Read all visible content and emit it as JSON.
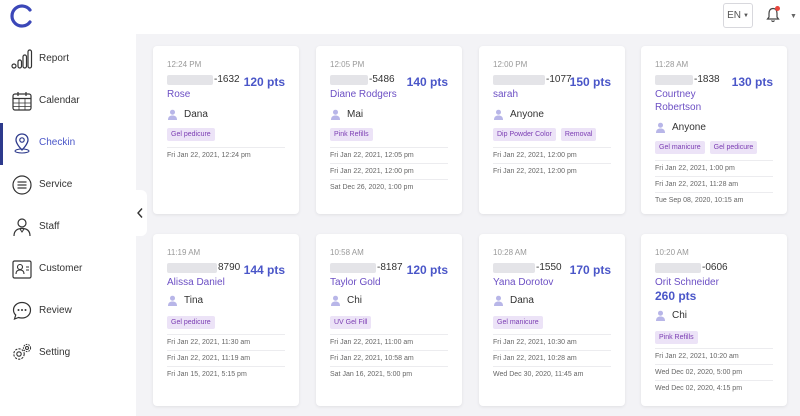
{
  "header": {
    "language": "EN"
  },
  "sidebar": {
    "items": [
      {
        "label": "Report",
        "icon": "bar-chart-icon"
      },
      {
        "label": "Calendar",
        "icon": "calendar-icon"
      },
      {
        "label": "Checkin",
        "icon": "location-pin-icon"
      },
      {
        "label": "Service",
        "icon": "list-icon"
      },
      {
        "label": "Staff",
        "icon": "staff-icon"
      },
      {
        "label": "Customer",
        "icon": "customer-icon"
      },
      {
        "label": "Review",
        "icon": "chat-icon"
      },
      {
        "label": "Setting",
        "icon": "gear-icon"
      }
    ],
    "active": "Checkin"
  },
  "cards": [
    {
      "time": "12:24 PM",
      "phone_suffix": "-1632",
      "points": "120 pts",
      "name": "Rose",
      "staff": "Dana",
      "services": [
        "Gel pedicure"
      ],
      "visits": [
        "Fri Jan 22, 2021, 12:24 pm"
      ]
    },
    {
      "time": "12:05 PM",
      "phone_suffix": "-5486",
      "points": "140 pts",
      "name": "Diane Rodgers",
      "staff": "Mai",
      "services": [
        "Pink Refills"
      ],
      "visits": [
        "Fri Jan 22, 2021, 12:05 pm",
        "Fri Jan 22, 2021, 12:00 pm",
        "Sat Dec 26, 2020, 1:00 pm"
      ]
    },
    {
      "time": "12:00 PM",
      "phone_suffix": "-1077",
      "points": "150 pts",
      "name": "sarah",
      "staff": "Anyone",
      "services": [
        "Dip Powder Color",
        "Removal"
      ],
      "visits": [
        "Fri Jan 22, 2021, 12:00 pm",
        "Fri Jan 22, 2021, 12:00 pm"
      ]
    },
    {
      "time": "11:28 AM",
      "phone_suffix": "-1838",
      "points": "130 pts",
      "name": "Courtney Robertson",
      "staff": "Anyone",
      "services": [
        "Gel manicure",
        "Gel pedicure"
      ],
      "visits": [
        "Fri Jan 22, 2021, 1:00 pm",
        "Fri Jan 22, 2021, 11:28 am",
        "Tue Sep 08, 2020, 10:15 am"
      ]
    },
    {
      "time": "11:19 AM",
      "phone_suffix": "8790",
      "points": "144 pts",
      "name": "Alissa Daniel",
      "staff": "Tina",
      "services": [
        "Gel pedicure"
      ],
      "visits": [
        "Fri Jan 22, 2021, 11:30 am",
        "Fri Jan 22, 2021, 11:19 am",
        "Fri Jan 15, 2021, 5:15 pm"
      ]
    },
    {
      "time": "10:58 AM",
      "phone_suffix": "-8187",
      "points": "120 pts",
      "name": "Taylor Gold",
      "staff": "Chi",
      "services": [
        "UV Gel Fill"
      ],
      "visits": [
        "Fri Jan 22, 2021, 11:00 am",
        "Fri Jan 22, 2021, 10:58 am",
        "Sat Jan 16, 2021, 5:00 pm"
      ]
    },
    {
      "time": "10:28 AM",
      "phone_suffix": "-1550",
      "points": "170 pts",
      "name": "Yana Dorotov",
      "staff": "Dana",
      "services": [
        "Gel manicure"
      ],
      "visits": [
        "Fri Jan 22, 2021, 10:30 am",
        "Fri Jan 22, 2021, 10:28 am",
        "Wed Dec 30, 2020, 11:45 am"
      ]
    },
    {
      "time": "10:20 AM",
      "phone_suffix": "-0606",
      "points": "260 pts",
      "name": "Orit Schneider",
      "staff": "Chi",
      "services": [
        "Pink Refills"
      ],
      "visits": [
        "Fri Jan 22, 2021, 10:20 am",
        "Wed Dec 02, 2020, 5:00 pm",
        "Wed Dec 02, 2020, 4:15 pm"
      ]
    }
  ],
  "colors": {
    "accent": "#4a56c8",
    "name": "#6c4fc4",
    "tag_text": "#7b3db3",
    "tag_bg": "#ece3f7",
    "active_bar": "#2d3a8c"
  }
}
